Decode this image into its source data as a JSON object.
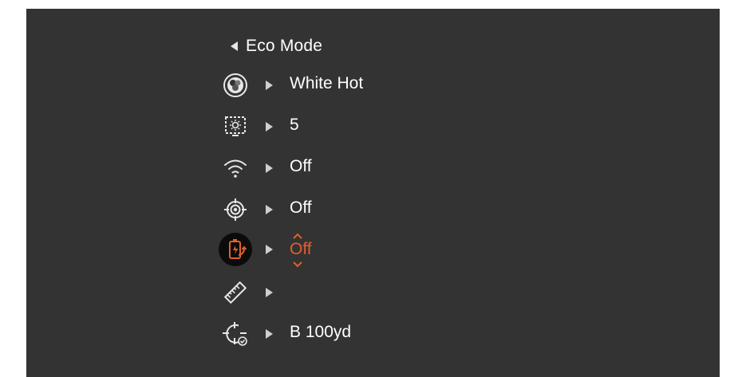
{
  "header": {
    "title": "Eco Mode",
    "back_icon": "left-triangle-icon"
  },
  "accent_color": "#e0602b",
  "menu": [
    {
      "icon": "palette-icon",
      "value": "White Hot"
    },
    {
      "icon": "display-brightness-icon",
      "value": "5"
    },
    {
      "icon": "wifi-icon",
      "value": "Off"
    },
    {
      "icon": "reticle-target-icon",
      "value": "Off"
    },
    {
      "icon": "battery-swap-icon",
      "value": "Off",
      "selected": true
    },
    {
      "icon": "ruler-icon",
      "value": ""
    },
    {
      "icon": "zeroing-crosshair-icon",
      "value": "B 100yd"
    }
  ]
}
